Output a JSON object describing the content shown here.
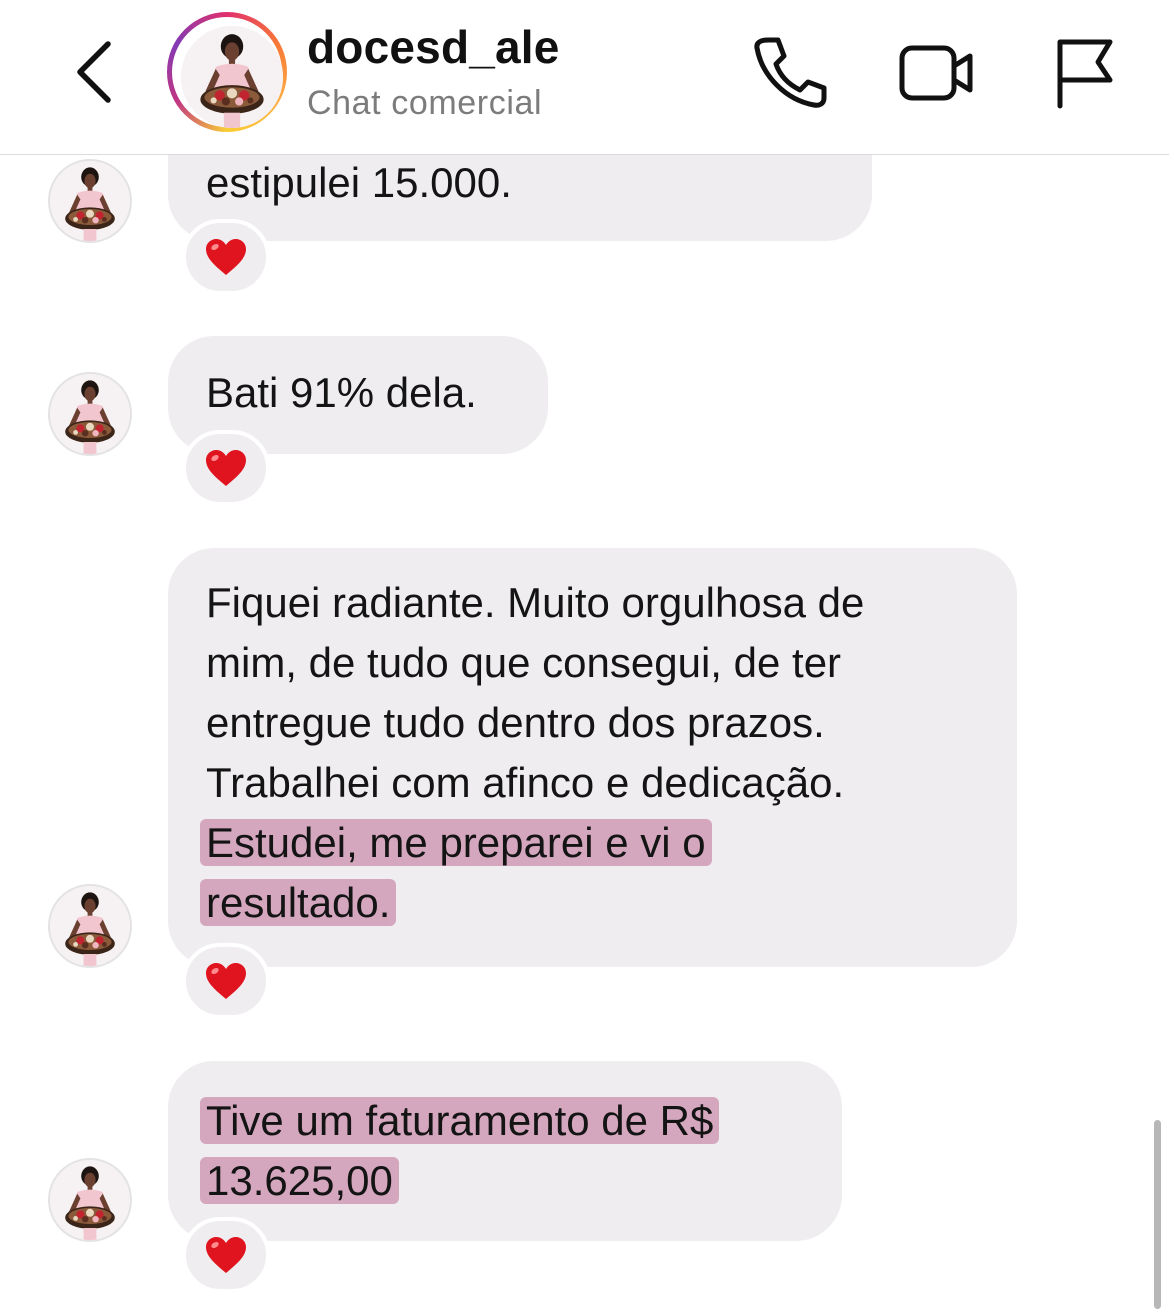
{
  "header": {
    "back_icon": "chevron-left-icon",
    "username": "docesd_ale",
    "subtitle": "Chat comercial",
    "actions": {
      "call_icon": "phone-icon",
      "video_icon": "video-camera-icon",
      "report_icon": "flag-icon"
    }
  },
  "messages": [
    {
      "lines": [
        "estipulei 15.000."
      ],
      "reaction": "❤️"
    },
    {
      "lines": [
        "Bati 91% dela."
      ],
      "reaction": "❤️"
    },
    {
      "lines": [
        "Fiquei radiante. Muito orgulhosa de",
        "mim, de tudo que consegui, de ter",
        "entregue tudo dentro dos prazos.",
        "Trabalhei com afinco e  dedicação.",
        "Estudei, me preparei e vi o",
        "resultado."
      ],
      "highlighted_lines": [
        4,
        5
      ],
      "reaction": "❤️"
    },
    {
      "lines": [
        "Tive um faturamento de R$",
        "13.625,00"
      ],
      "highlighted_lines": [
        0,
        1
      ],
      "reaction": "❤️"
    }
  ],
  "colors": {
    "bubble": "#efedf0",
    "highlight": "#be6e96",
    "subtitle": "#7c7c7c",
    "reaction_heart": "#e0141e"
  }
}
